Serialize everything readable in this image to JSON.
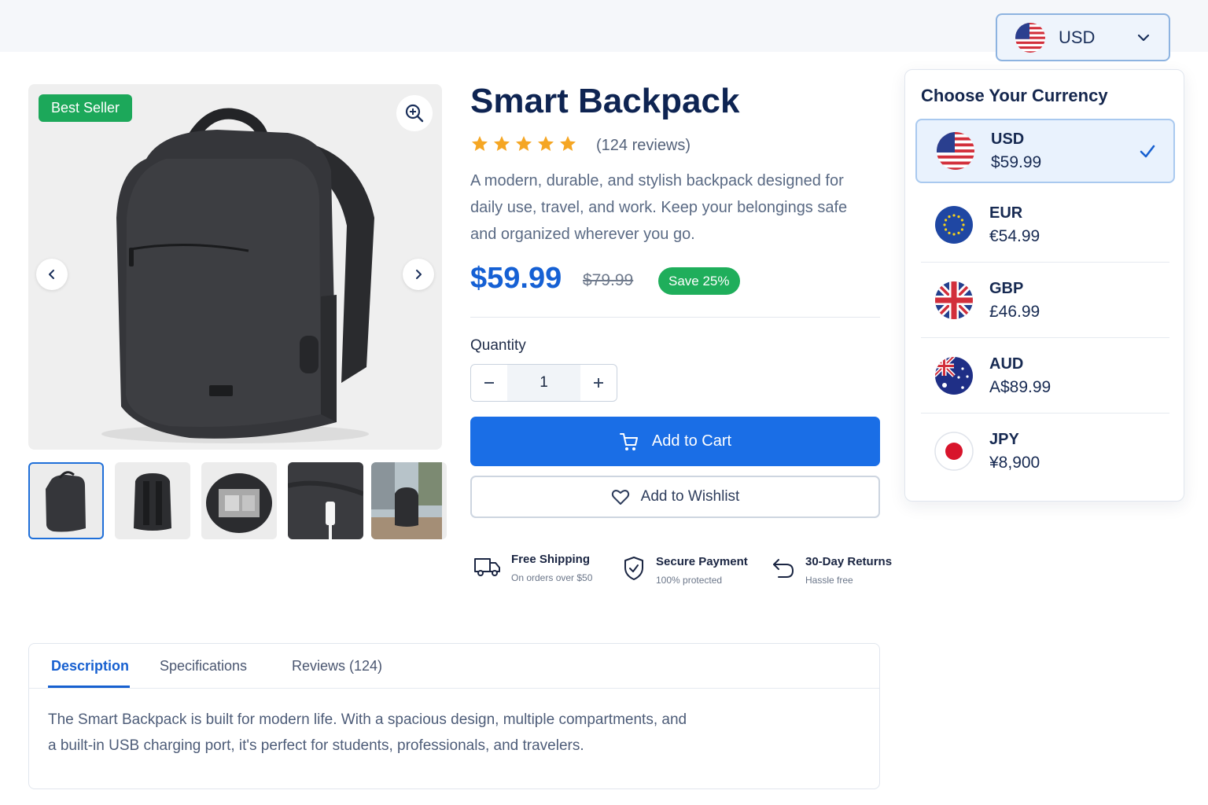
{
  "header": {
    "currency_selected": "USD"
  },
  "product": {
    "badge": "Best Seller",
    "title": "Smart Backpack",
    "rating": 5,
    "reviews": "(124 reviews)",
    "description": "A modern, durable, and stylish backpack designed for daily use, travel, and work. Keep your belongings safe and organized wherever you go.",
    "price": "$59.99",
    "old_price": "$79.99",
    "save": "Save 25%",
    "quantity_label": "Quantity",
    "quantity": "1",
    "add_to_cart": "Add to Cart",
    "add_to_wishlist": "Add to Wishlist"
  },
  "features": [
    {
      "title": "Free Shipping",
      "subtitle": "On orders over $50",
      "icon": "truck-icon"
    },
    {
      "title": "Secure Payment",
      "subtitle": "100% protected",
      "icon": "shield-check-icon"
    },
    {
      "title": "30-Day Returns",
      "subtitle": "Hassle free",
      "icon": "return-arrow-icon"
    }
  ],
  "currency_panel": {
    "title": "Choose Your Currency",
    "options": [
      {
        "code": "USD",
        "price": "$59.99",
        "flag": "us-flag-icon",
        "selected": true
      },
      {
        "code": "EUR",
        "price": "€54.99",
        "flag": "eu-flag-icon",
        "selected": false
      },
      {
        "code": "GBP",
        "price": "£46.99",
        "flag": "uk-flag-icon",
        "selected": false
      },
      {
        "code": "AUD",
        "price": "A$89.99",
        "flag": "au-flag-icon",
        "selected": false
      },
      {
        "code": "JPY",
        "price": "¥8,900",
        "flag": "jp-flag-icon",
        "selected": false
      }
    ]
  },
  "tabs": {
    "items": [
      "Description",
      "Specifications",
      "Reviews (124)"
    ],
    "active": "Description",
    "content": "The Smart Backpack is built for modern life. With a spacious design, multiple compartments, and a built-in USB charging port, it's perfect for students, professionals, and travelers."
  },
  "colors": {
    "primary": "#1a6ee6",
    "success": "#1fae5b",
    "star": "#f5a623",
    "text_dark": "#0e2452"
  }
}
